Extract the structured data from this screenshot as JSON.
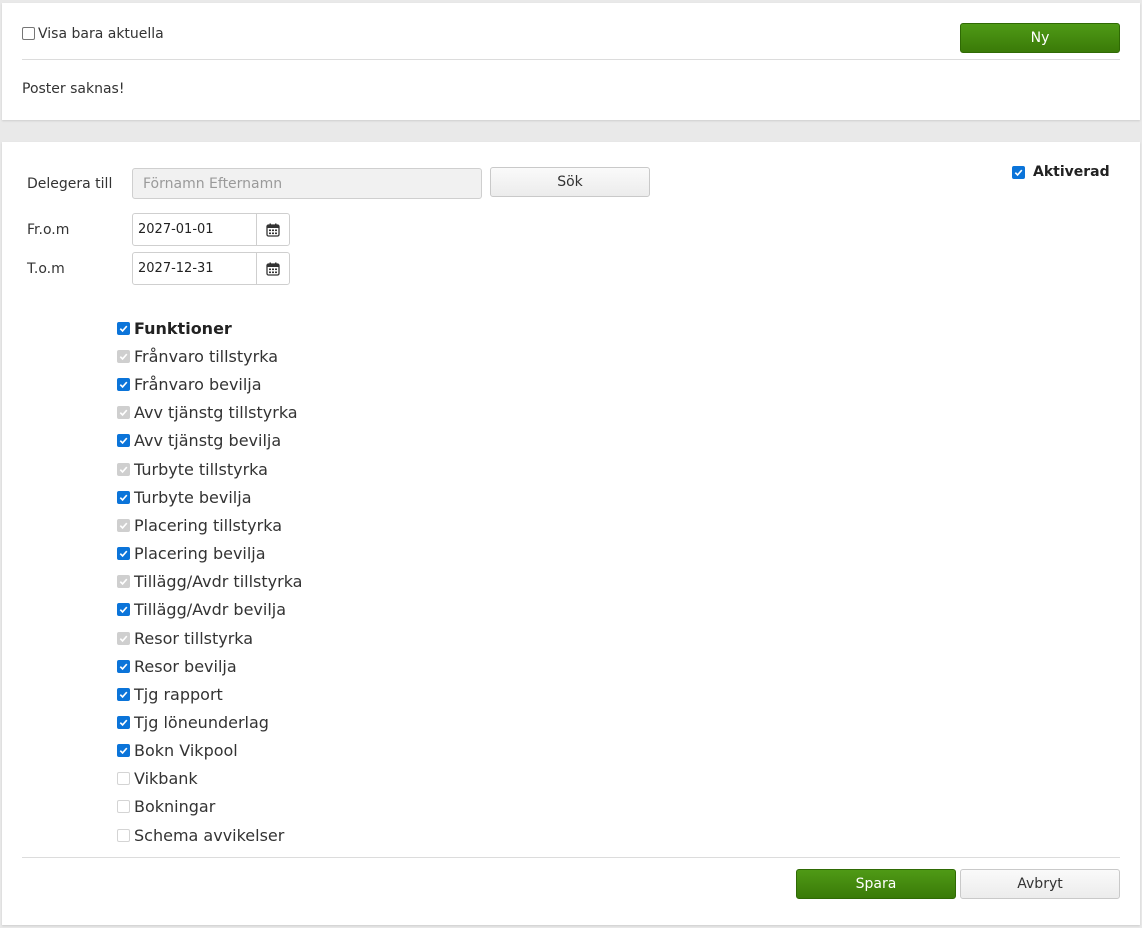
{
  "top": {
    "show_current_label": "Visa bara aktuella",
    "show_current_checked": false,
    "new_button": "Ny",
    "empty_message": "Poster saknas!"
  },
  "form": {
    "delegate_label": "Delegera till",
    "delegate_placeholder": "Förnamn Efternamn",
    "search_button": "Sök",
    "activated_label": "Aktiverad",
    "activated_checked": true,
    "from_label": "Fr.o.m",
    "from_value": "2027-01-01",
    "to_label": "T.o.m",
    "to_value": "2027-12-31",
    "functions_header": "Funktioner",
    "functions": [
      {
        "label": "Frånvaro tillstyrka",
        "state": "disabled-checked"
      },
      {
        "label": "Frånvaro bevilja",
        "state": "checked"
      },
      {
        "label": "Avv tjänstg tillstyrka",
        "state": "disabled-checked"
      },
      {
        "label": "Avv tjänstg bevilja",
        "state": "checked"
      },
      {
        "label": "Turbyte tillstyrka",
        "state": "disabled-checked"
      },
      {
        "label": "Turbyte bevilja",
        "state": "checked"
      },
      {
        "label": "Placering tillstyrka",
        "state": "disabled-checked"
      },
      {
        "label": "Placering bevilja",
        "state": "checked"
      },
      {
        "label": "Tillägg/Avdr tillstyrka",
        "state": "disabled-checked"
      },
      {
        "label": "Tillägg/Avdr bevilja",
        "state": "checked"
      },
      {
        "label": "Resor tillstyrka",
        "state": "disabled-checked"
      },
      {
        "label": "Resor bevilja",
        "state": "checked"
      },
      {
        "label": "Tjg rapport",
        "state": "checked"
      },
      {
        "label": "Tjg löneunderlag",
        "state": "checked"
      },
      {
        "label": "Bokn Vikpool",
        "state": "checked"
      },
      {
        "label": "Vikbank",
        "state": "disabled-unchecked"
      },
      {
        "label": "Bokningar",
        "state": "disabled-unchecked"
      },
      {
        "label": "Schema avvikelser",
        "state": "disabled-unchecked"
      }
    ],
    "save_button": "Spara",
    "cancel_button": "Avbryt"
  },
  "colors": {
    "accent_green": "#3f820b",
    "checkbox_blue": "#0b74d9"
  }
}
